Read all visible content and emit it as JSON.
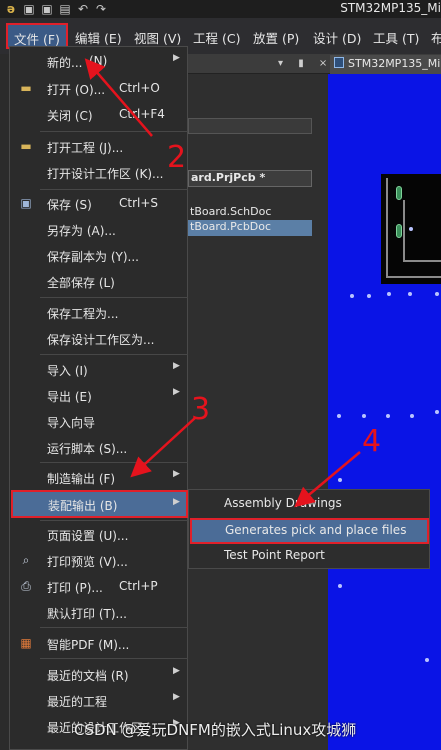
{
  "window": {
    "title": "STM32MP135_Mi"
  },
  "menubar": {
    "items": [
      "文件 (F)",
      "编辑 (E)",
      "视图 (V)",
      "工程 (C)",
      "放置 (P)",
      "设计 (D)",
      "工具 (T)",
      "布"
    ]
  },
  "file_menu": {
    "items": [
      {
        "label": "新的...",
        "shortcut": "(N)"
      },
      {
        "label": "打开 (O)...",
        "shortcut": "Ctrl+O"
      },
      {
        "label": "关闭 (C)",
        "shortcut": "Ctrl+F4"
      },
      {
        "label": "打开工程 (J)..."
      },
      {
        "label": "打开设计工作区 (K)..."
      },
      {
        "label": "保存 (S)",
        "shortcut": "Ctrl+S"
      },
      {
        "label": "另存为 (A)..."
      },
      {
        "label": "保存副本为 (Y)..."
      },
      {
        "label": "全部保存 (L)"
      },
      {
        "label": "保存工程为..."
      },
      {
        "label": "保存设计工作区为..."
      },
      {
        "label": "导入 (I)"
      },
      {
        "label": "导出 (E)"
      },
      {
        "label": "导入向导"
      },
      {
        "label": "运行脚本 (S)..."
      },
      {
        "label": "制造输出 (F)"
      },
      {
        "label": "装配输出 (B)"
      },
      {
        "label": "页面设置 (U)..."
      },
      {
        "label": "打印预览 (V)..."
      },
      {
        "label": "打印 (P)...",
        "shortcut": "Ctrl+P"
      },
      {
        "label": "默认打印 (T)..."
      },
      {
        "label": "智能PDF (M)..."
      },
      {
        "label": "最近的文档 (R)"
      },
      {
        "label": "最近的工程"
      },
      {
        "label": "最近的设计工作区"
      }
    ]
  },
  "assembly_submenu": {
    "items": [
      "Assembly Drawings",
      "Generates pick and place files",
      "Test Point Report"
    ]
  },
  "projects_panel": {
    "project_file": "ard.PrjPcb *",
    "docs": [
      "tBoard.SchDoc",
      "tBoard.PcbDoc"
    ]
  },
  "document_tab": {
    "label": "STM32MP135_Mi"
  },
  "annotations": [
    "2",
    "3",
    "4"
  ],
  "watermark": "CSDN @爱玩DNFM的嵌入式Linux攻城狮",
  "colors": {
    "highlight": "#4b6c97",
    "annotation_red": "#e0202a",
    "pcb_blue": "#0a14e6"
  }
}
